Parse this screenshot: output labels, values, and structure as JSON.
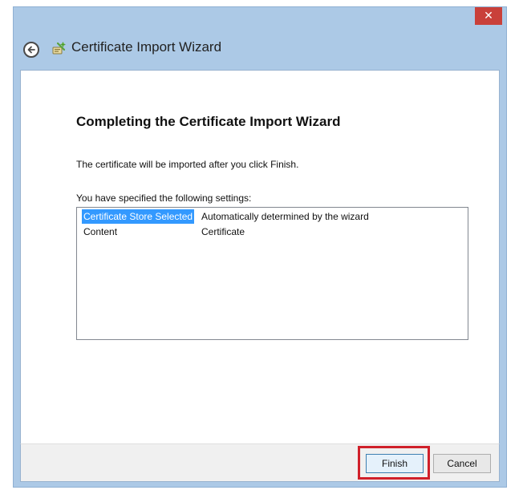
{
  "window": {
    "title": "Certificate Import Wizard",
    "close_label": "✕"
  },
  "page": {
    "heading": "Completing the Certificate Import Wizard",
    "description": "The certificate will be imported after you click Finish.",
    "settings_label": "You have specified the following settings:",
    "settings": [
      {
        "key": "Certificate Store Selected",
        "value": "Automatically determined by the wizard",
        "selected": true
      },
      {
        "key": "Content",
        "value": "Certificate",
        "selected": false
      }
    ]
  },
  "footer": {
    "finish_label": "Finish",
    "cancel_label": "Cancel"
  },
  "colors": {
    "accent_highlight": "#d0202a",
    "selection": "#3399ff",
    "close_button": "#c9403a"
  },
  "icons": {
    "back": "back-arrow-icon",
    "wizard": "certificate-wizard-icon",
    "close": "close-icon"
  }
}
